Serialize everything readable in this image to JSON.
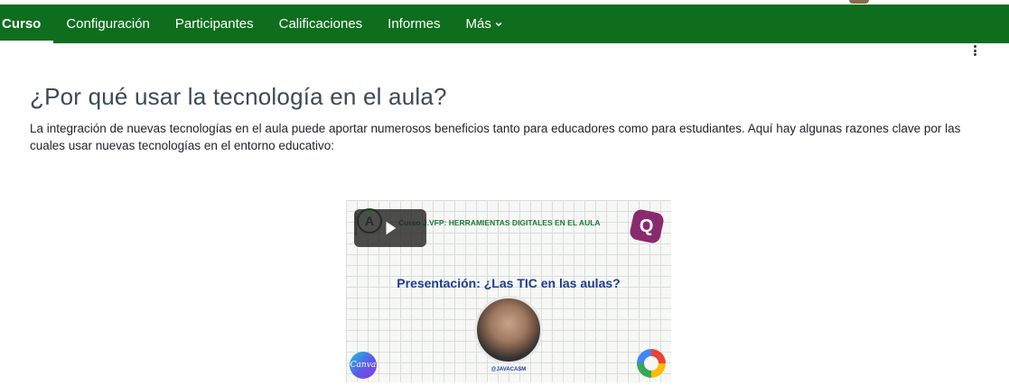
{
  "nav": {
    "items": [
      {
        "label": "Curso",
        "active": true
      },
      {
        "label": "Configuración",
        "active": false
      },
      {
        "label": "Participantes",
        "active": false
      },
      {
        "label": "Calificaciones",
        "active": false
      },
      {
        "label": "Informes",
        "active": false
      },
      {
        "label": "Más",
        "active": false,
        "has_dropdown": true
      }
    ],
    "background_color": "#0f6e1e"
  },
  "page": {
    "title": "¿Por qué usar la tecnología en el aula?",
    "intro": "La integración de nuevas tecnologías en el aula puede aportar numerosos beneficios tanto para educadores como para estudiantes. Aquí hay algunas razones clave por las cuales usar nuevas tecnologías en el entorno educativo:"
  },
  "video": {
    "header_text": "Curso J.VFP: HERRAMIENTAS DIGITALES EN EL AULA",
    "title": "Presentación: ¿Las TIC en las aulas?",
    "handle": "@JAVACASM",
    "logo_letter": "A",
    "q_icon": "Q",
    "canva_label": "Canva"
  }
}
